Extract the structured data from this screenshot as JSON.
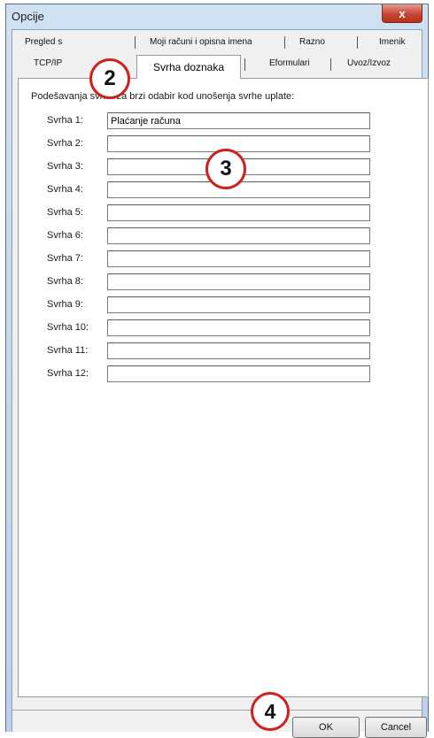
{
  "window": {
    "title": "Opcije",
    "close_label": "x"
  },
  "tabs": {
    "row1": [
      "Pregled s",
      "Moji računi i opisna imena",
      "Razno",
      "Imenik"
    ],
    "row2": [
      "TCP/IP",
      "Svrha doznaka",
      "Eformulari",
      "Uvoz/Izvoz"
    ],
    "active": "Svrha doznaka"
  },
  "panel": {
    "instruction": "Podešavanja svrha za brzi odabir kod unošenja svrhe uplate:",
    "rows": [
      {
        "label": "Svrha 1:",
        "value": "Plaćanje računa"
      },
      {
        "label": "Svrha 2:",
        "value": ""
      },
      {
        "label": "Svrha 3:",
        "value": ""
      },
      {
        "label": "Svrha 4:",
        "value": ""
      },
      {
        "label": "Svrha 5:",
        "value": ""
      },
      {
        "label": "Svrha 6:",
        "value": ""
      },
      {
        "label": "Svrha 7:",
        "value": ""
      },
      {
        "label": "Svrha 8:",
        "value": ""
      },
      {
        "label": "Svrha 9:",
        "value": ""
      },
      {
        "label": "Svrha 10:",
        "value": ""
      },
      {
        "label": "Svrha 11:",
        "value": ""
      },
      {
        "label": "Svrha 12:",
        "value": ""
      }
    ]
  },
  "buttons": {
    "ok": "OK",
    "cancel": "Cancel"
  },
  "callouts": {
    "c2": "2",
    "c3": "3",
    "c4": "4"
  },
  "colors": {
    "callout_ring": "#d0201a",
    "close_button": "#c64633"
  }
}
